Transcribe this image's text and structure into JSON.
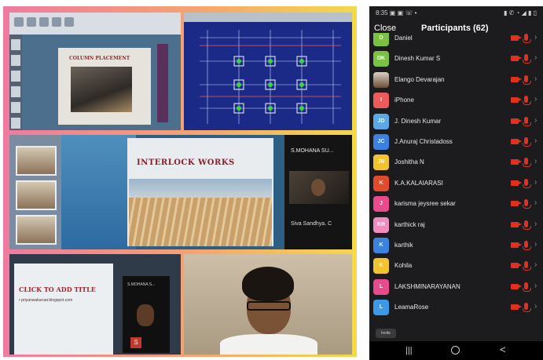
{
  "collage": {
    "tile1": {
      "slide_title": "COLUMN PLACEMENT"
    },
    "tile3": {
      "slide_title": "INTERLOCK WORKS",
      "speaker_name": "S.MOHANA SU...",
      "sub_name": "Siva Sandhya. C"
    },
    "tile4": {
      "doc_title": "CLICK TO ADD TITLE",
      "doc_sub": "• priyanwakuruar.blogspot.com",
      "phone_name": "S.MOHANA S...",
      "badge": "S"
    }
  },
  "phone": {
    "status": {
      "left": "8:35 ▣ ▣ ☏ •",
      "right": "▮ ✆ ◔ ◢ ▮ ▯"
    },
    "close_label": "Close",
    "title": "Participants (62)",
    "participants": [
      {
        "initials": "D",
        "name": "Daniel",
        "color": "#7cc242",
        "photo": false
      },
      {
        "initials": "DK",
        "name": "Dinesh Kumar S",
        "color": "#7cc242",
        "photo": false
      },
      {
        "initials": "",
        "name": "Elango Devarajan",
        "color": "#8a6e5a",
        "photo": true
      },
      {
        "initials": "I",
        "name": "iPhone",
        "color": "#ec5a5a",
        "photo": false
      },
      {
        "initials": "JD",
        "name": "J. Dinesh Kumar",
        "color": "#5aa9e6",
        "photo": false
      },
      {
        "initials": "JC",
        "name": "J.Anuraj Christadoss",
        "color": "#3b82e0",
        "photo": false
      },
      {
        "initials": "JN",
        "name": "Joshitha N",
        "color": "#f2c230",
        "photo": false
      },
      {
        "initials": "K",
        "name": "K.A.KALAIARASI",
        "color": "#e24a2b",
        "photo": false
      },
      {
        "initials": "J",
        "name": "karisma jeysree sekar",
        "color": "#e84a8c",
        "photo": false
      },
      {
        "initials": "KR",
        "name": "karthick raj",
        "color": "#f08cc0",
        "photo": false
      },
      {
        "initials": "K",
        "name": "karthik",
        "color": "#3b82e0",
        "photo": false
      },
      {
        "initials": "K",
        "name": "Kohila",
        "color": "#f2c230",
        "photo": false
      },
      {
        "initials": "L",
        "name": "LAKSHMINARAYANAN",
        "color": "#e84a8c",
        "photo": false
      },
      {
        "initials": "L",
        "name": "LeamaRose",
        "color": "#3b9ae8",
        "photo": false
      }
    ],
    "invite_label": "Invite",
    "nav": {
      "recents": "|||",
      "back": "<"
    }
  }
}
